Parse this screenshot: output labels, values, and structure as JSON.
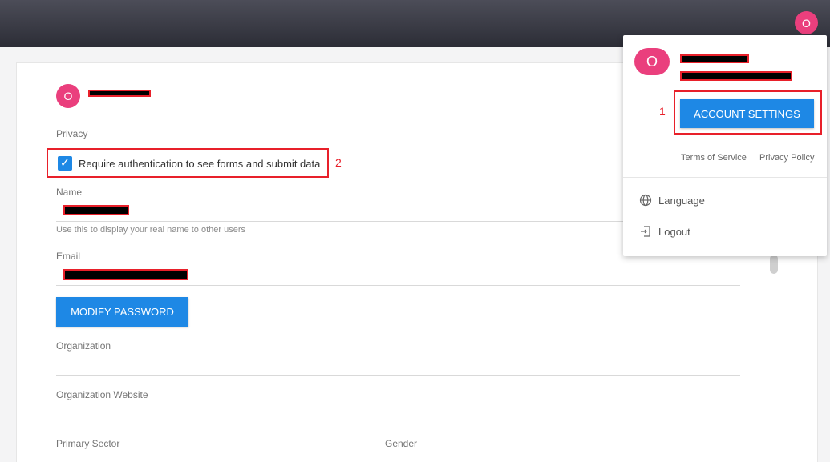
{
  "header": {
    "avatar_initial": "O"
  },
  "profile": {
    "avatar_initial": "O",
    "privacy_label": "Privacy",
    "require_auth_label": "Require authentication to see forms and submit data",
    "require_auth_checked": true,
    "name_label": "Name",
    "name_hint": "Use this to display your real name to other users",
    "email_label": "Email",
    "modify_password_label": "MODIFY PASSWORD",
    "organization_label": "Organization",
    "organization_website_label": "Organization Website",
    "primary_sector_label": "Primary Sector",
    "gender_label": "Gender"
  },
  "dropdown": {
    "avatar_initial": "O",
    "account_settings_label": "ACCOUNT SETTINGS",
    "terms_label": "Terms of Service",
    "privacy_policy_label": "Privacy Policy",
    "language_label": "Language",
    "logout_label": "Logout"
  },
  "annotations": {
    "one": "1",
    "two": "2"
  },
  "colors": {
    "accent": "#1e88e5",
    "avatar": "#ea3f7d",
    "annotation": "#e8202a"
  },
  "icons": {
    "check": "check-icon",
    "language": "globe-icon",
    "logout": "logout-icon"
  }
}
